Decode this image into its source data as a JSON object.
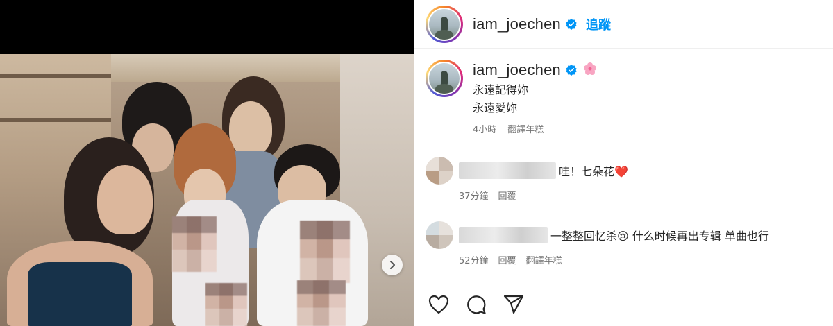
{
  "post": {
    "username": "iam_joechen",
    "follow_label": "追蹤",
    "caption_lines": [
      "永遠記得妳",
      "永遠愛妳"
    ],
    "caption_time": "4小時",
    "caption_translate": "翻譯年糕"
  },
  "comments": [
    {
      "text": "哇！七朵花❤️",
      "time": "37分鐘",
      "reply": "回覆",
      "translate": ""
    },
    {
      "text": "一整整回忆杀😢 什么时候再出专辑 单曲也行",
      "time": "52分鐘",
      "reply": "回覆",
      "translate": "翻譯年糕"
    }
  ],
  "icons": {
    "verified": "verified-badge-icon",
    "flower": "flower-emoji-icon",
    "next": "chevron-right-icon",
    "like": "heart-icon",
    "comment": "speech-bubble-icon",
    "share": "paper-plane-icon"
  },
  "colors": {
    "link": "#0095f6",
    "verified": "#0095f6",
    "muted": "#737373"
  }
}
